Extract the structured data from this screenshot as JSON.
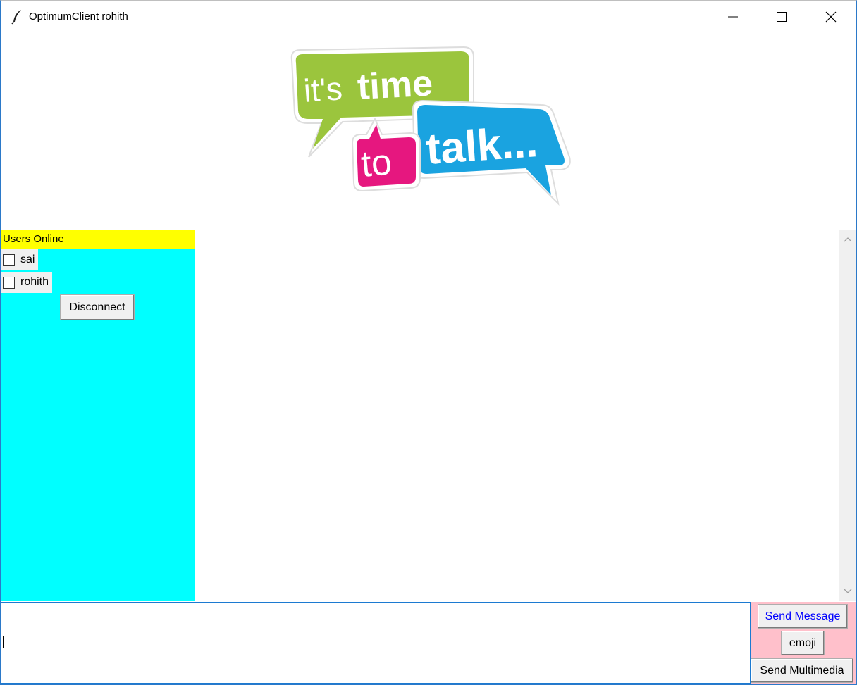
{
  "window": {
    "title": "OptimumClient rohith",
    "icon": "feather-icon",
    "controls": [
      "minimize-icon",
      "maximize-icon",
      "close-icon"
    ]
  },
  "logo": {
    "line1_a": "it's",
    "line1_b": "time",
    "line2_a": "to",
    "line2_b": "talk...",
    "colors": {
      "green": "#9bc53d",
      "pink": "#e6177f",
      "blue": "#1aa3e0"
    }
  },
  "users_panel": {
    "header": "Users Online",
    "users": [
      {
        "name": "sai",
        "checked": false
      },
      {
        "name": "rohith",
        "checked": false
      }
    ],
    "disconnect_label": "Disconnect",
    "bg_color": "#00ffff",
    "header_color": "#ffff00"
  },
  "chat": {
    "messages": []
  },
  "compose": {
    "value": ""
  },
  "actions": {
    "send_message_label": "Send Message",
    "emoji_label": "emoji",
    "send_multimedia_label": "Send Multimedia",
    "panel_color": "#ffc0cb"
  }
}
